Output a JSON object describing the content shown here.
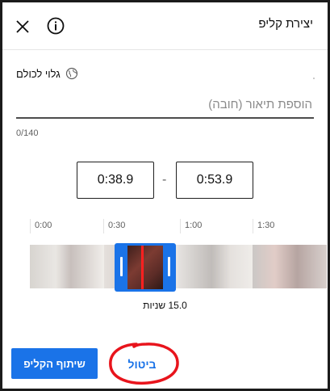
{
  "header": {
    "title": "יצירת קליפ",
    "close_icon": "close-icon",
    "info_icon": "info-icon"
  },
  "visibility": {
    "label": "גלוי לכולם",
    "icon": "globe-icon"
  },
  "description": {
    "placeholder": "הוספת תיאור (חובה)",
    "value": "",
    "counter": "0/140"
  },
  "clip": {
    "start_time": "0:38.9",
    "separator": "-",
    "end_time": "0:53.9",
    "duration_label": "15.0 שניות"
  },
  "timeline": {
    "ticks": [
      "0:00",
      "0:30",
      "1:00",
      "1:30"
    ]
  },
  "footer": {
    "share_label": "שיתוף הקליפ",
    "cancel_label": "ביטול"
  },
  "colors": {
    "accent": "#1a73e8",
    "playhead": "#ff2020",
    "annotation": "#e8141c"
  }
}
